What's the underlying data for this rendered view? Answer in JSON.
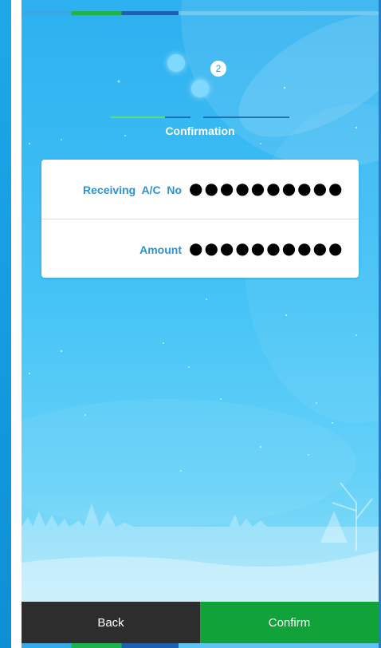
{
  "wizard": {
    "step_number": "2",
    "step_title": "Confirmation"
  },
  "form": {
    "rows": [
      {
        "label": "Receiving  A/C  No",
        "value": "●●●●●●●●●●"
      },
      {
        "label": "Amount",
        "value": "●●●●●●●●●●"
      }
    ]
  },
  "footer": {
    "back_label": "Back",
    "confirm_label": "Confirm"
  },
  "colors": {
    "background": "#2cb0f0",
    "label": "#2d92d0",
    "confirm": "#12a23a",
    "back": "#2d2d2d"
  }
}
